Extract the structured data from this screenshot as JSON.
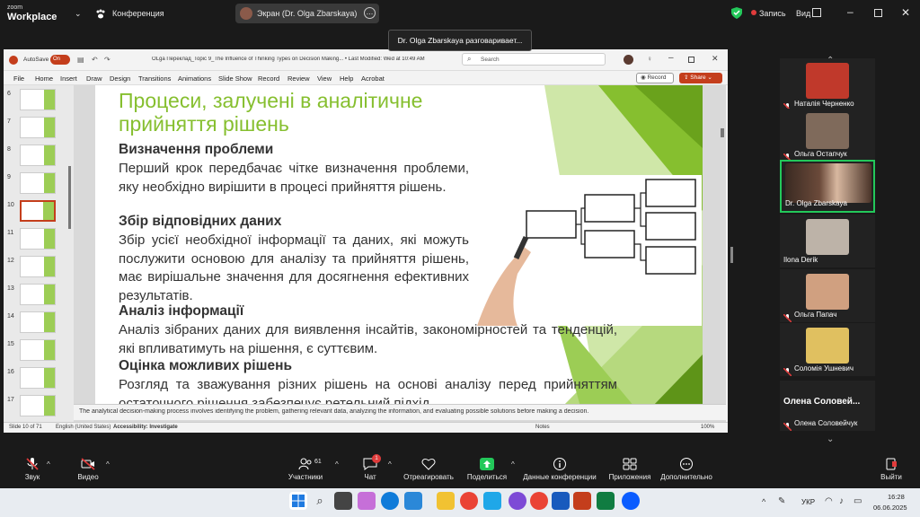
{
  "zoom": {
    "logo_line1": "zoom",
    "logo_line2": "Workplace",
    "conference_label": "Конференция",
    "screen_share_label": "Экран (Dr. Olga Zbarskaya)",
    "recording_label": "Запись",
    "view_label": "Вид",
    "speaking_tooltip": "Dr. Olga Zbarskaya разговаривает..."
  },
  "ppt": {
    "autosave": "AutoSave",
    "autosave_state": "On",
    "filename": "OLga Переклад_Topic 9_The Influence of Thinking Types on Decision Making... • Last Modified: Wed at 10:49 AM",
    "search_placeholder": "Search",
    "menu": [
      "File",
      "Home",
      "Insert",
      "Draw",
      "Design",
      "Transitions",
      "Animations",
      "Slide Show",
      "Record",
      "Review",
      "View",
      "Help",
      "Acrobat"
    ],
    "record_btn": "Record",
    "share_btn": "Share",
    "thumb_numbers": [
      "6",
      "7",
      "8",
      "9",
      "10",
      "11",
      "12",
      "13",
      "14",
      "15",
      "16",
      "17"
    ],
    "notes_text": "The analytical decision-making process involves identifying the problem, gathering relevant data, analyzing the information, and evaluating possible solutions before making a decision.",
    "status_slide": "Slide 10 of 71",
    "status_lang": "English (United States)",
    "status_access": "Accessibility: Investigate",
    "status_notes": "Notes",
    "status_zoom": "100%"
  },
  "slide": {
    "title": "Процеси, залучені в аналітичне прийняття рішень",
    "h1": "Визначення проблеми",
    "p1": "Перший крок передбачає чітке визначення проблеми, яку необхідно вирішити в процесі прийняття рішень.",
    "h2": "Збір відповідних даних",
    "p2": "Збір усієї необхідної інформації та даних, які можуть послужити основою для аналізу та прийняття рішень, має вирішальне значення для досягнення ефективних результатів.",
    "h3": "Аналіз інформації",
    "p3": "Аналіз зібраних даних для виявлення інсайтів, закономірностей та тенденцій, які впливатимуть на рішення, є суттєвим.",
    "h4": "Оцінка можливих рішень",
    "p4": "Розгляд та зважування різних рішень на основі аналізу перед прийняттям остаточного рішення забезпечує ретельний підхід."
  },
  "participants": [
    {
      "name": "Наталія Черненко",
      "muted": true,
      "color": "#c0392b"
    },
    {
      "name": "Ольга Остапчук",
      "muted": true,
      "color": "#7f6a5b"
    },
    {
      "name": "Dr. Olga Zbarskaya",
      "muted": false,
      "active": true,
      "color": "#6b4a3a"
    },
    {
      "name": "Ilona Derik",
      "muted": false,
      "color": "#bdb3a8"
    },
    {
      "name": "Ольга Папач",
      "muted": true,
      "color": "#d0a080"
    },
    {
      "name": "Соломія Ушневич",
      "muted": true,
      "color": "#e0c060"
    },
    {
      "name": "Олена Соловейчук",
      "short": "Олена Соловей...",
      "muted": true
    }
  ],
  "toolbar": {
    "audio": "Звук",
    "video": "Видео",
    "participants": "Участники",
    "participants_count": "61",
    "chat": "Чат",
    "chat_badge": "1",
    "react": "Отреагировать",
    "share": "Поделиться",
    "info": "Данные конференции",
    "apps": "Приложения",
    "more": "Дополнительно",
    "leave": "Выйти"
  },
  "taskbar": {
    "lang": "УКР",
    "time": "16:28",
    "date": "06.06.2025"
  }
}
